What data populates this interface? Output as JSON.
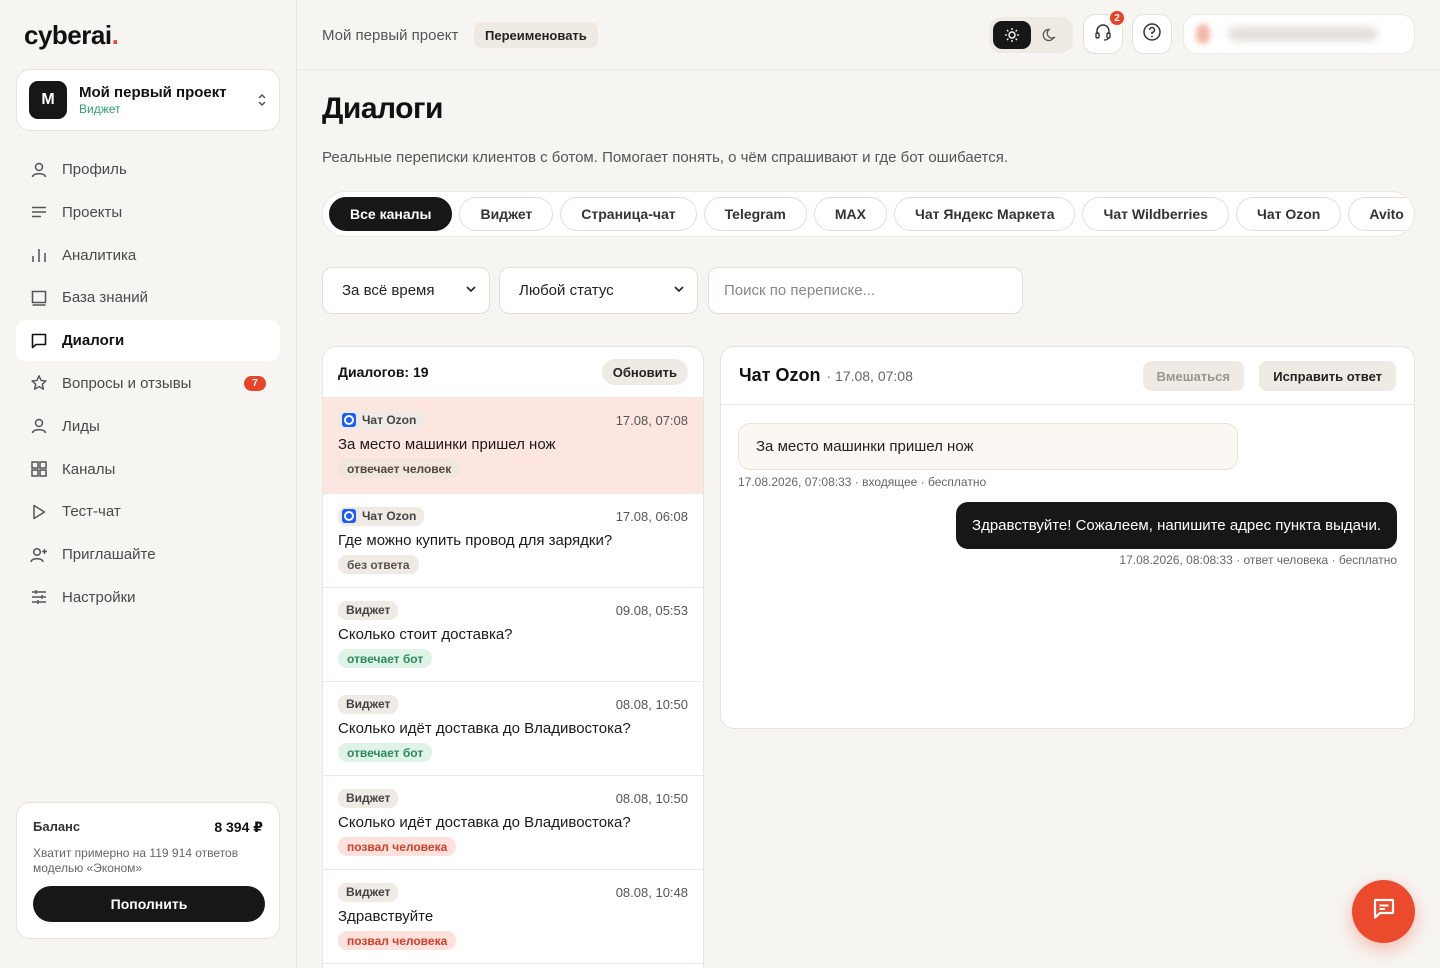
{
  "brand": {
    "logo_text": "cyberai",
    "logo_dot": ".",
    "accent": "#ec4a2d"
  },
  "project": {
    "avatar_letter": "M",
    "name": "Мой первый проект",
    "type": "Виджет"
  },
  "nav": {
    "items": [
      {
        "label": "Профиль",
        "icon": "user-icon"
      },
      {
        "label": "Проекты",
        "icon": "list-icon"
      },
      {
        "label": "Аналитика",
        "icon": "bar-chart-icon"
      },
      {
        "label": "База знаний",
        "icon": "book-icon"
      },
      {
        "label": "Диалоги",
        "icon": "chat-icon",
        "active": true
      },
      {
        "label": "Вопросы и отзывы",
        "icon": "star-icon",
        "badge": "7"
      },
      {
        "label": "Лиды",
        "icon": "user-icon"
      },
      {
        "label": "Каналы",
        "icon": "grid-icon"
      },
      {
        "label": "Тест-чат",
        "icon": "play-icon"
      },
      {
        "label": "Приглашайте",
        "icon": "user-plus-icon"
      },
      {
        "label": "Настройки",
        "icon": "sliders-icon"
      }
    ]
  },
  "balance": {
    "label": "Баланс",
    "value": "8 394 ₽",
    "note": "Хватит примерно на 119 914 ответов моделью «Эконом»",
    "topup_label": "Пополнить"
  },
  "header": {
    "project_name": "Мой первый проект",
    "rename_label": "Переименовать",
    "support_badge": "2",
    "theme": "light"
  },
  "page": {
    "title": "Диалоги",
    "description": "Реальные переписки клиентов с ботом. Помогает понять, о чём спрашивают и где бот ошибается."
  },
  "channels": [
    "Все каналы",
    "Виджет",
    "Страница-чат",
    "Telegram",
    "MAX",
    "Чат Яндекс Маркета",
    "Чат Wildberries",
    "Чат Ozon",
    "Avito"
  ],
  "filters": {
    "period": "За всё время",
    "status": "Любой статус",
    "search_placeholder": "Поиск по переписке..."
  },
  "list": {
    "count_label": "Диалогов: 19",
    "refresh_label": "Обновить",
    "dialogs": [
      {
        "source": "Чат Ozon",
        "ozon": true,
        "time": "17.08, 07:08",
        "text": "За место машинки пришел нож",
        "status": "отвечает человек",
        "status_kind": "human",
        "selected": true
      },
      {
        "source": "Чат Ozon",
        "ozon": true,
        "time": "17.08, 06:08",
        "text": "Где можно купить провод для зарядки?",
        "status": "без ответа",
        "status_kind": "noans"
      },
      {
        "source": "Виджет",
        "time": "09.08, 05:53",
        "text": "Сколько стоит доставка?",
        "status": "отвечает бот",
        "status_kind": "bot"
      },
      {
        "source": "Виджет",
        "time": "08.08, 10:50",
        "text": "Сколько идёт доставка до Владивостока?",
        "status": "отвечает бот",
        "status_kind": "bot"
      },
      {
        "source": "Виджет",
        "time": "08.08, 10:50",
        "text": "Сколько идёт доставка до Владивостока?",
        "status": "позвал человека",
        "status_kind": "called"
      },
      {
        "source": "Виджет",
        "time": "08.08, 10:48",
        "text": "Здравствуйте",
        "status": "позвал человека",
        "status_kind": "called"
      }
    ]
  },
  "chat": {
    "title": "Чат Ozon",
    "meta": "· 17.08, 07:08",
    "intervene_label": "Вмешаться",
    "fix_label": "Исправить ответ",
    "incoming": {
      "text": "За место машинки пришел нож",
      "meta": "17.08.2026, 07:08:33 · входящее · бесплатно"
    },
    "outgoing": {
      "text": "Здравствуйте! Сожалеем, напишите адрес пункта выдачи.",
      "meta": "17.08.2026, 08:08:33 · ответ человека · бесплатно"
    }
  }
}
